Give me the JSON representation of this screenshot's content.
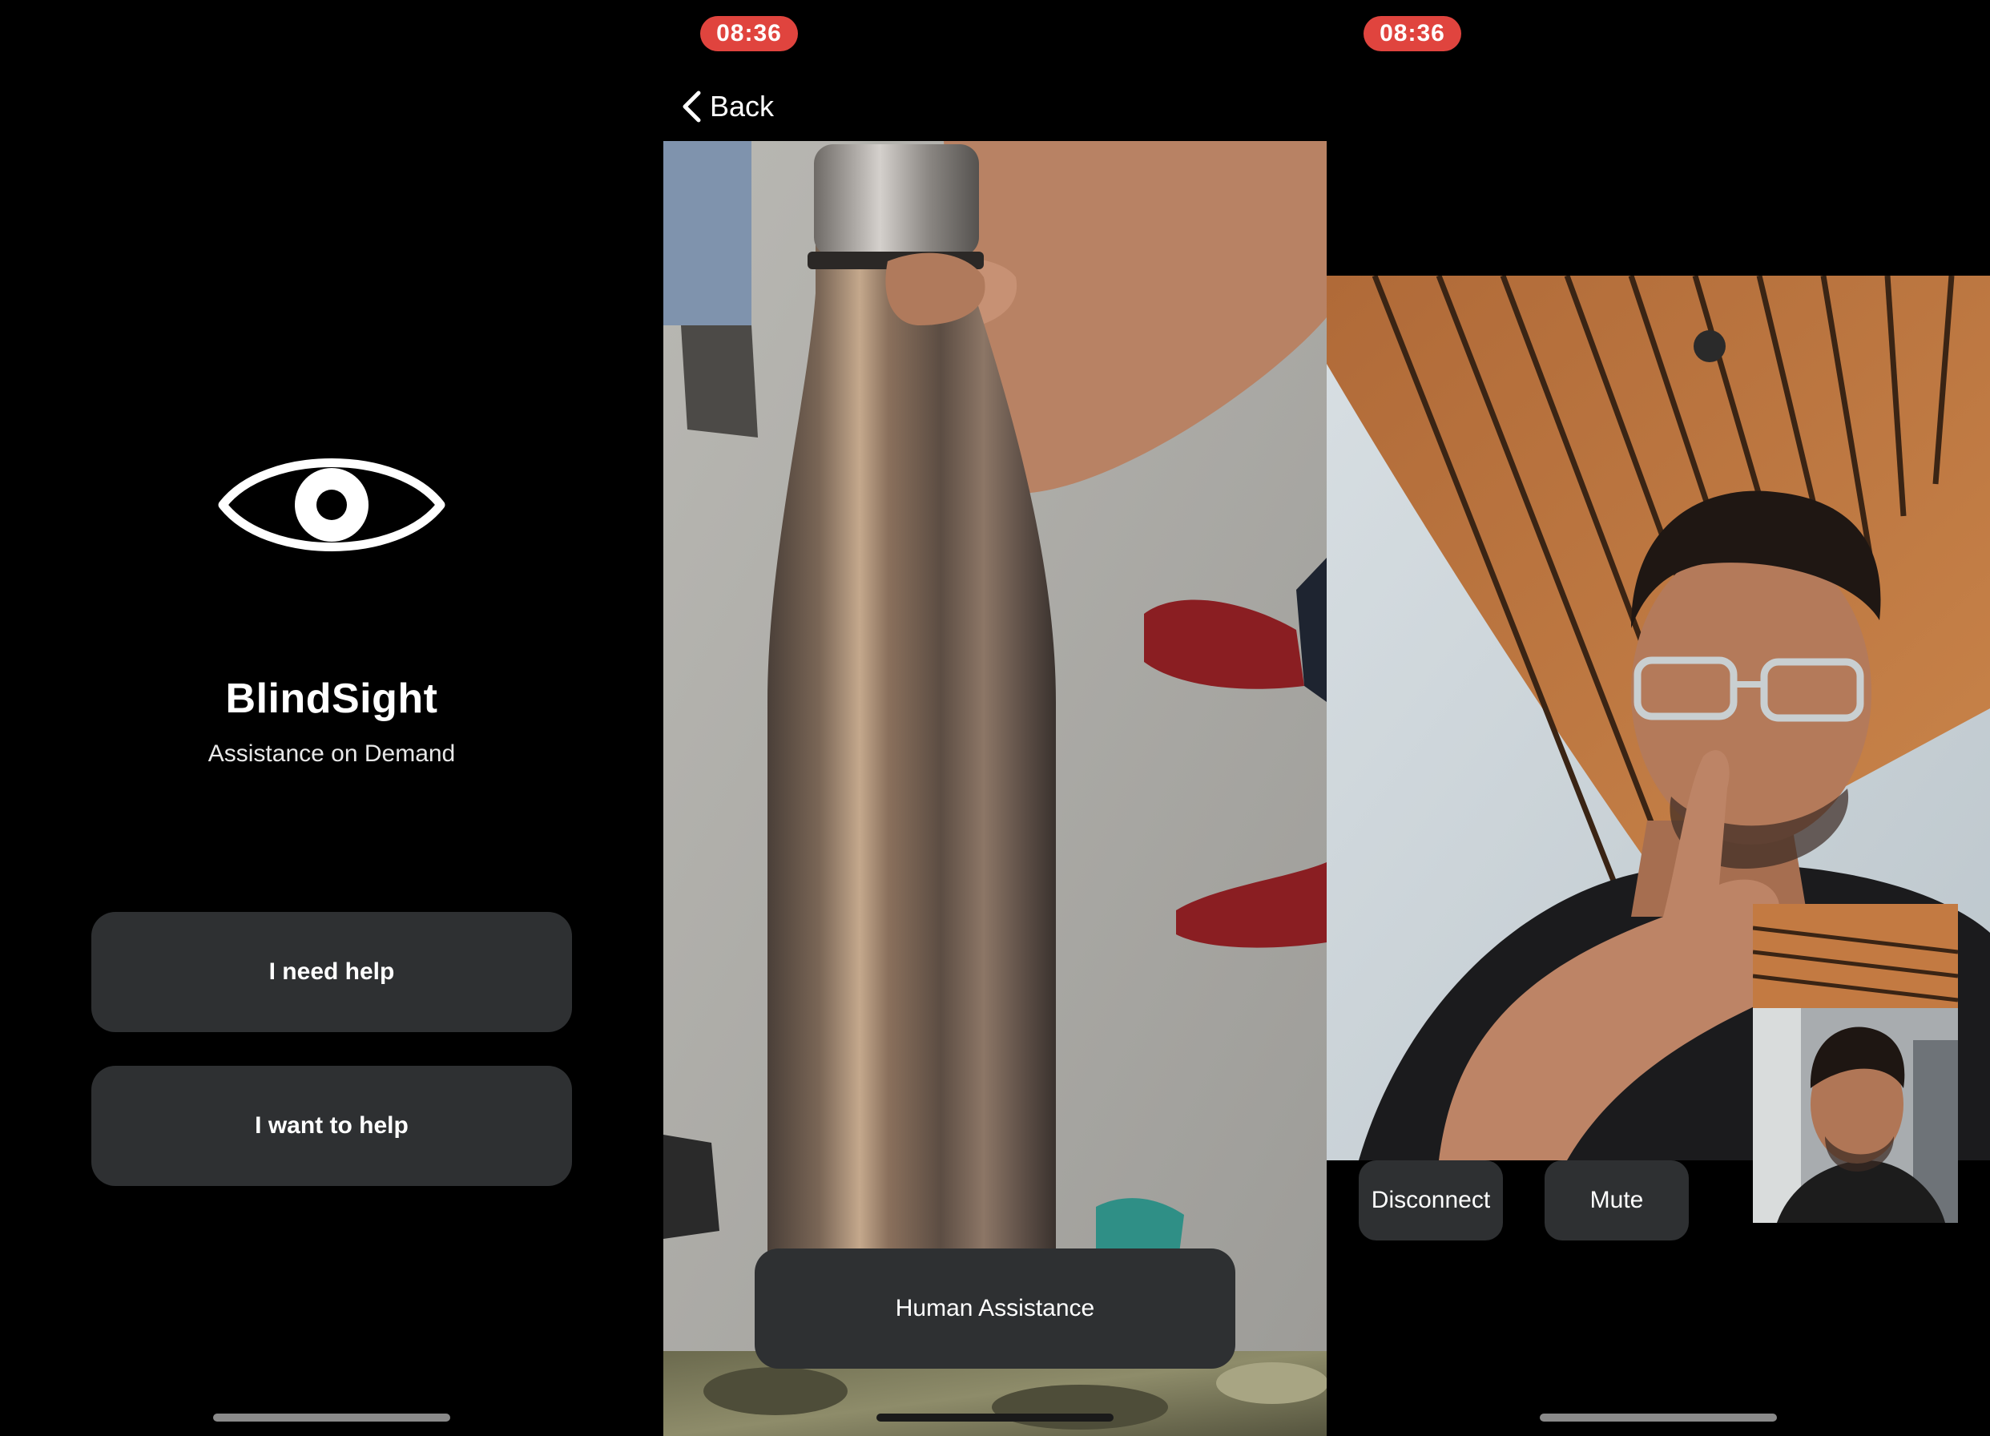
{
  "screen_home": {
    "app_title": "BlindSight",
    "app_subtitle": "Assistance on Demand",
    "need_help_label": "I need help",
    "want_help_label": "I want to help",
    "icon": "eye-icon"
  },
  "screen_camera": {
    "time": "08:36",
    "back_label": "Back",
    "human_assistance_label": "Human Assistance"
  },
  "screen_call": {
    "time": "08:36",
    "disconnect_label": "Disconnect",
    "mute_label": "Mute"
  },
  "colors": {
    "background": "#000000",
    "button_bg": "#2e3032",
    "time_pill": "#e0443e"
  }
}
